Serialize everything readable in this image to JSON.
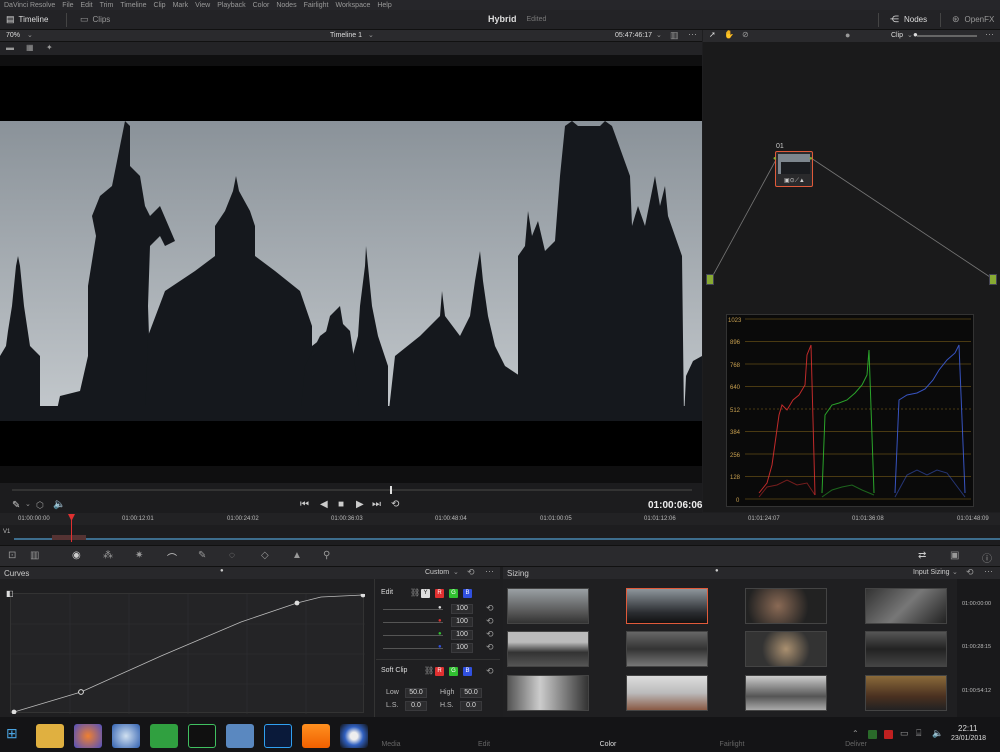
{
  "menubar": {
    "app": "DaVinci Resolve",
    "items": [
      "File",
      "Edit",
      "Trim",
      "Timeline",
      "Clip",
      "Mark",
      "View",
      "Playback",
      "Color",
      "Nodes",
      "Fairlight",
      "Workspace",
      "Help"
    ]
  },
  "tabs": {
    "timeline": "Timeline",
    "clips": "Clips",
    "project": "Hybrid",
    "status": "Edited",
    "nodes": "Nodes",
    "openfx": "OpenFX"
  },
  "viewer": {
    "zoom": "70%",
    "timeline_name": "Timeline 1",
    "timecode": "05:47:46:17",
    "clip_mode": "Clip"
  },
  "transport": {
    "timecode": "01:00:06:06"
  },
  "timeline": {
    "ruler": [
      "01:00:00:00",
      "01:00:12:01",
      "01:00:24:02",
      "01:00:36:03",
      "01:00:48:04",
      "01:01:00:05",
      "01:01:12:06",
      "01:01:24:07",
      "01:01:36:08",
      "01:01:48:09"
    ],
    "track": "V1"
  },
  "node": {
    "label": "01"
  },
  "scope": {
    "ticks": [
      "1023",
      "896",
      "768",
      "640",
      "512",
      "384",
      "256",
      "128",
      "0"
    ]
  },
  "curves": {
    "title": "Curves",
    "mode": "Custom",
    "edit_label": "Edit",
    "channels": [
      "Y",
      "R",
      "G",
      "B"
    ],
    "values": [
      "100",
      "100",
      "100",
      "100"
    ],
    "softclip_label": "Soft Clip",
    "low_label": "Low",
    "low": "50.0",
    "high_label": "High",
    "high": "50.0",
    "ls_label": "L.S.",
    "ls": "0.0",
    "hs_label": "H.S.",
    "hs": "0.0"
  },
  "sizing": {
    "title": "Sizing",
    "mode": "Input Sizing",
    "times": [
      "01:00:00:00",
      "01:00:28:15",
      "01:00:54:12"
    ]
  },
  "pages": [
    "Media",
    "Edit",
    "Color",
    "Fairlight",
    "Deliver"
  ],
  "taskbar": {
    "time": "22:11",
    "date": "23/01/2018"
  },
  "colors": {
    "accent": "#e05a3a",
    "red": "#e03030",
    "green": "#30c030",
    "blue": "#3050e0"
  }
}
